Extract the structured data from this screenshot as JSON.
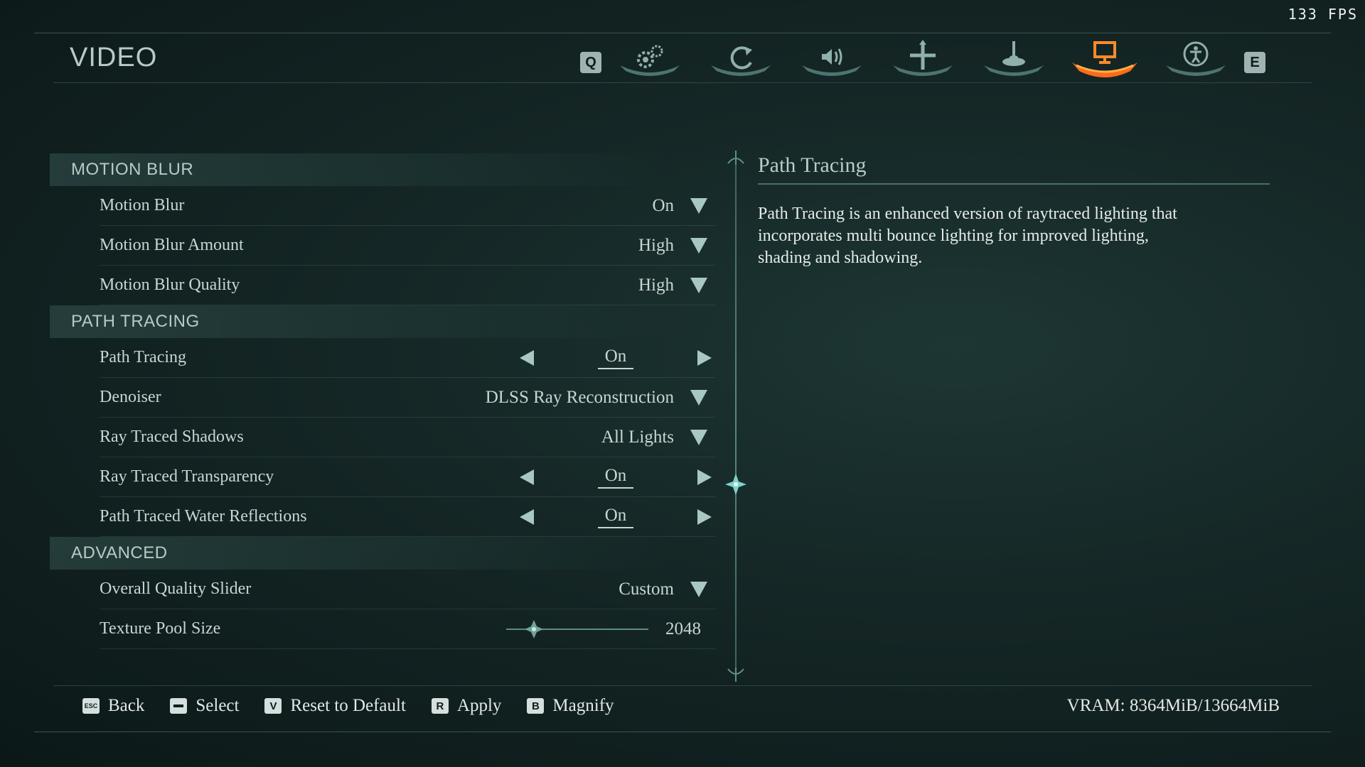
{
  "fps_counter": "133 FPS",
  "page_title": "VIDEO",
  "tabs": {
    "prev_key": "Q",
    "next_key": "E",
    "items": [
      {
        "icon": "gears-icon",
        "active": false
      },
      {
        "icon": "rotate-icon",
        "active": false
      },
      {
        "icon": "speaker-icon",
        "active": false
      },
      {
        "icon": "crosshair-icon",
        "active": false
      },
      {
        "icon": "joystick-icon",
        "active": false
      },
      {
        "icon": "monitor-icon",
        "active": true
      },
      {
        "icon": "accessibility-icon",
        "active": false
      }
    ],
    "active_color": "#ff6a1a"
  },
  "sections": {
    "motion_blur": {
      "header": "MOTION BLUR",
      "rows": [
        {
          "label": "Motion Blur",
          "value": "On"
        },
        {
          "label": "Motion Blur Amount",
          "value": "High"
        },
        {
          "label": "Motion Blur Quality",
          "value": "High"
        }
      ]
    },
    "path_tracing": {
      "header": "PATH TRACING",
      "rows": [
        {
          "label": "Path Tracing",
          "value": "On"
        },
        {
          "label": "Denoiser",
          "value": "DLSS Ray Reconstruction"
        },
        {
          "label": "Ray Traced Shadows",
          "value": "All Lights"
        },
        {
          "label": "Ray Traced Transparency",
          "value": "On"
        },
        {
          "label": "Path Traced Water Reflections",
          "value": "On"
        }
      ]
    },
    "advanced": {
      "header": "ADVANCED",
      "rows": [
        {
          "label": "Overall Quality Slider",
          "value": "Custom"
        },
        {
          "label": "Texture Pool Size",
          "value": "2048",
          "slider_fraction": 0.2
        }
      ]
    }
  },
  "description": {
    "title": "Path Tracing",
    "body": "Path Tracing is an enhanced version of raytraced lighting that incorporates multi bounce lighting for improved lighting, shading and shadowing."
  },
  "footer": {
    "back": {
      "key": "ESC",
      "label": "Back"
    },
    "select": {
      "key": "",
      "label": "Select"
    },
    "reset": {
      "key": "V",
      "label": "Reset to Default"
    },
    "apply": {
      "key": "R",
      "label": "Apply"
    },
    "magnify": {
      "key": "B",
      "label": "Magnify"
    },
    "vram": "VRAM: 8364MiB/13664MiB"
  }
}
